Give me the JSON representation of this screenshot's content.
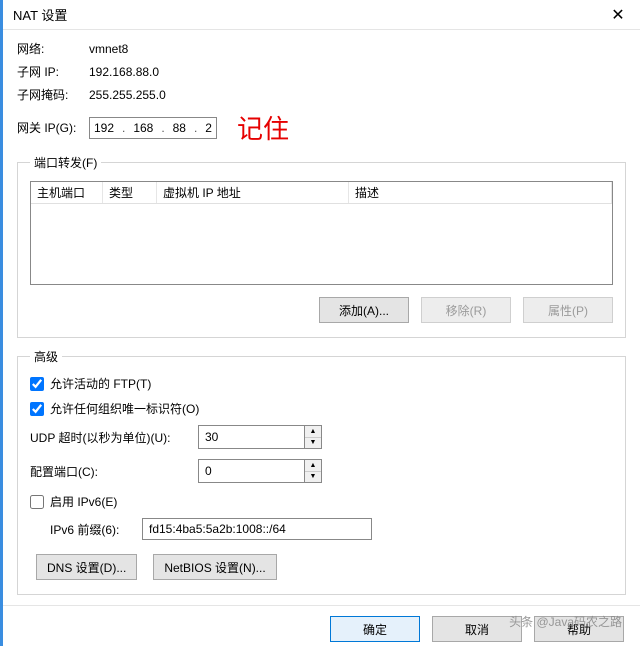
{
  "window": {
    "title": "NAT 设置"
  },
  "network": {
    "label": "网络:",
    "value": "vmnet8"
  },
  "subnet_ip": {
    "label": "子网 IP:",
    "value": "192.168.88.0"
  },
  "subnet_mask": {
    "label": "子网掩码:",
    "value": "255.255.255.0"
  },
  "gateway": {
    "label": "网关 IP(G):",
    "octets": [
      "192",
      "168",
      "88",
      "2"
    ]
  },
  "annotation": "记住",
  "port_forward": {
    "legend": "端口转发(F)",
    "columns": {
      "host": "主机端口",
      "type": "类型",
      "vmip": "虚拟机 IP 地址",
      "desc": "描述"
    }
  },
  "buttons": {
    "add": "添加(A)...",
    "remove": "移除(R)",
    "properties": "属性(P)",
    "dns": "DNS 设置(D)...",
    "netbios": "NetBIOS 设置(N)...",
    "ok": "确定",
    "cancel": "取消",
    "help": "帮助"
  },
  "advanced": {
    "legend": "高级",
    "allow_active_ftp": "允许活动的 FTP(T)",
    "allow_org_oui": "允许任何组织唯一标识符(O)",
    "udp_timeout_label": "UDP 超时(以秒为单位)(U):",
    "udp_timeout_value": "30",
    "config_port_label": "配置端口(C):",
    "config_port_value": "0",
    "enable_ipv6": "启用 IPv6(E)",
    "ipv6_prefix_label": "IPv6 前缀(6):",
    "ipv6_prefix_value": "fd15:4ba5:5a2b:1008::/64"
  },
  "watermark": "头条 @Java码农之路"
}
